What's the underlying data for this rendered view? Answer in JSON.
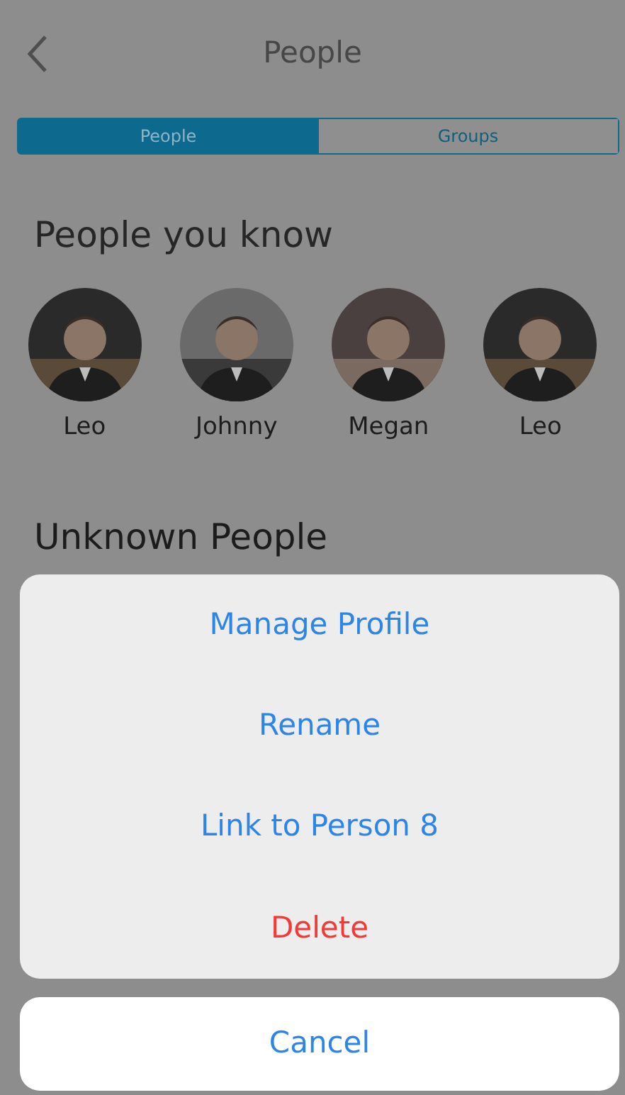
{
  "header": {
    "title": "People"
  },
  "tabs": [
    {
      "label": "People",
      "selected": true
    },
    {
      "label": "Groups",
      "selected": false
    }
  ],
  "known_section": {
    "heading": "People you know",
    "people": [
      {
        "name": "Leo",
        "kind": "picture"
      },
      {
        "name": "Johnny",
        "kind": "picture"
      },
      {
        "name": "Megan",
        "kind": "picture"
      },
      {
        "name": "Leo",
        "kind": "picture"
      }
    ]
  },
  "unknown_section": {
    "heading": "Unknown People"
  },
  "action_sheet": {
    "actions": [
      {
        "label": "Manage Profile",
        "kind": "default"
      },
      {
        "label": "Rename",
        "kind": "default"
      },
      {
        "label": "Link to Person 8",
        "kind": "default"
      },
      {
        "label": "Delete",
        "kind": "destructive"
      }
    ],
    "cancel": "Cancel"
  }
}
